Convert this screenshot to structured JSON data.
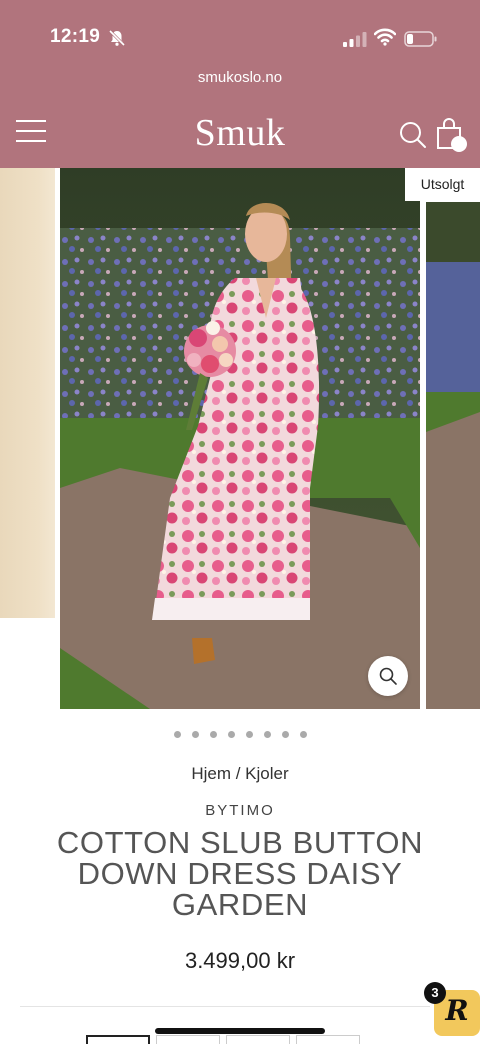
{
  "status_bar": {
    "time": "12:19"
  },
  "browser": {
    "url": "smukoslo.no"
  },
  "header": {
    "brand": "Smuk"
  },
  "gallery": {
    "badge": "Utsolgt",
    "slide_count": 8,
    "active_slide": 1
  },
  "product": {
    "breadcrumb": "Hjem / Kjoler",
    "vendor": "BYTIMO",
    "title": "COTTON SLUB BUTTON DOWN DRESS DAISY GARDEN",
    "price": "3.499,00 kr"
  },
  "reviews_widget": {
    "logo": "R",
    "count": "3"
  },
  "colors": {
    "header_bg": "#b1747d",
    "reviews_bg": "#f2c85c"
  }
}
